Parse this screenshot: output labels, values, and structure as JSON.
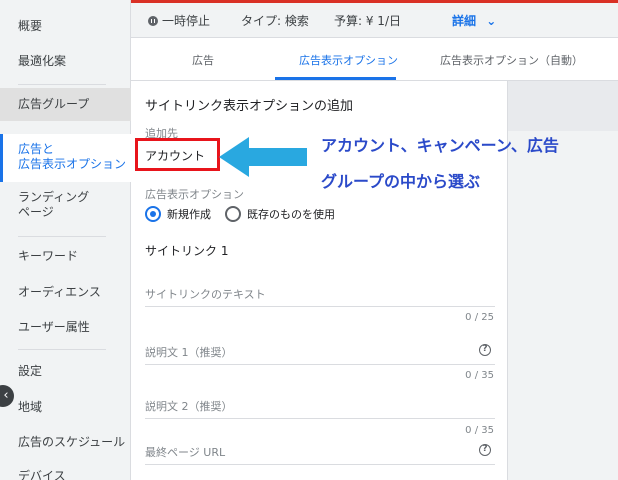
{
  "sidebar": {
    "items": [
      "概要",
      "最適化案",
      "広告グループ",
      "広告と",
      "広告表示オプション",
      "ランディング",
      "ページ",
      "キーワード",
      "オーディエンス",
      "ユーザー属性",
      "設定",
      "地域",
      "広告のスケジュール",
      "デバイス"
    ],
    "collapse_glyph": "‹"
  },
  "topbar": {
    "status": "一時停止",
    "type": "タイプ: 検索",
    "budget": "予算: ¥ 1/日",
    "details": "詳細",
    "details_chevron": "⌄"
  },
  "tabs": [
    "広告",
    "広告表示オプション",
    "広告表示オプション（自動）"
  ],
  "panel": {
    "title": "サイトリンク表示オプションの追加",
    "add_to_label": "追加先",
    "add_to_value": "アカウント",
    "ext_label": "広告表示オプション",
    "radio_new": "新規作成",
    "radio_existing": "既存のものを使用",
    "sitelink_heading": "サイトリンク 1",
    "fields": [
      {
        "placeholder": "サイトリンクのテキスト",
        "counter": "0 / 25"
      },
      {
        "placeholder": "説明文 1（推奨）",
        "counter": "0 / 35"
      },
      {
        "placeholder": "説明文 2（推奨）",
        "counter": "0 / 35"
      },
      {
        "placeholder": "最終ページ URL",
        "counter": ""
      }
    ],
    "help_glyph": "?"
  },
  "annotation": {
    "line1": "アカウント、キャンペーン、広告",
    "line2": "グループの中から選ぶ"
  },
  "colors": {
    "accent": "#1a73e8",
    "highlight_box": "#e8141b",
    "arrow": "#29a8e0",
    "annotation_text": "#2b4ac9"
  }
}
